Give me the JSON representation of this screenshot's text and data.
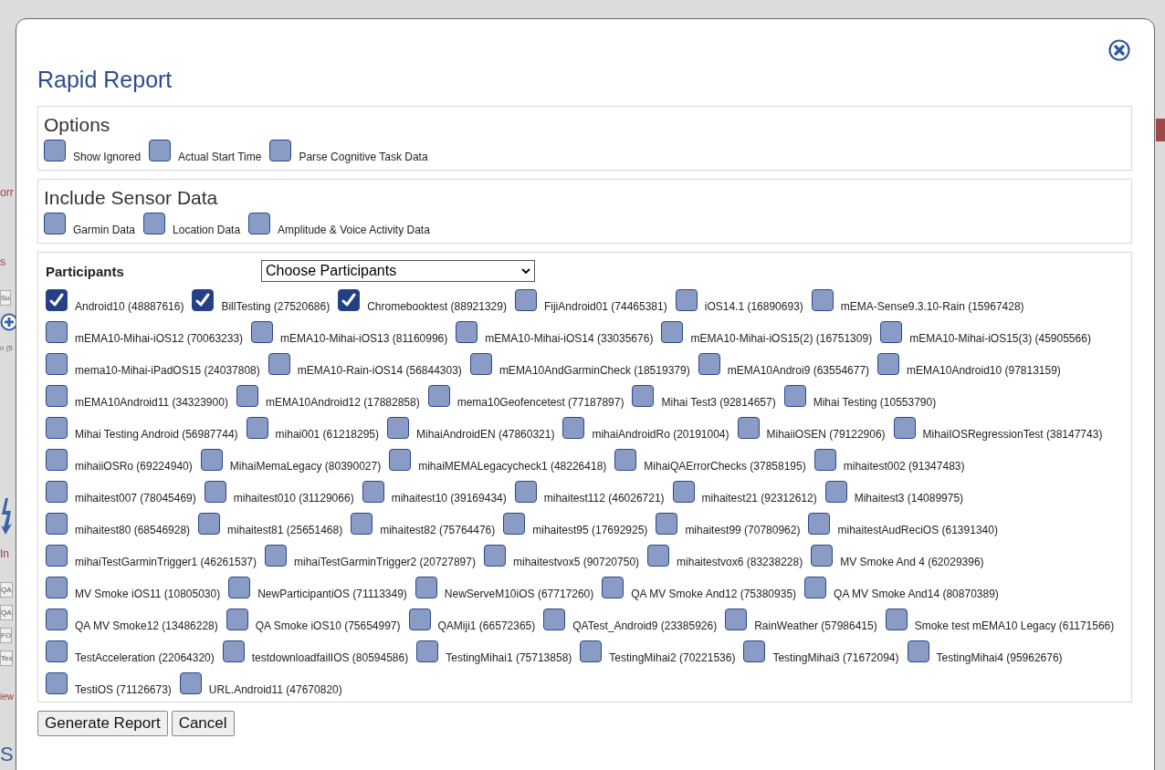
{
  "background": {
    "left_fragments": [
      {
        "kind": "heading",
        "text": "orr"
      },
      {
        "kind": "heading",
        "text": "s"
      },
      {
        "kind": "cell",
        "text": "Su"
      },
      {
        "kind": "plus"
      },
      {
        "kind": "text",
        "text": "n (5"
      },
      {
        "kind": "bolt"
      },
      {
        "kind": "heading",
        "text": "In"
      },
      {
        "kind": "cell",
        "text": "QA"
      },
      {
        "kind": "cell",
        "text": "QA"
      },
      {
        "kind": "cell",
        "text": "FO"
      },
      {
        "kind": "cell",
        "text": "Tex"
      },
      {
        "kind": "link",
        "text": "iew"
      },
      {
        "kind": "title",
        "text": "S"
      }
    ]
  },
  "dialog": {
    "title": "Rapid Report"
  },
  "options": {
    "heading": "Options",
    "items": [
      {
        "label": "Show Ignored",
        "checked": false
      },
      {
        "label": "Actual Start Time",
        "checked": false
      },
      {
        "label": "Parse Cognitive Task Data",
        "checked": false
      }
    ]
  },
  "sensor_data": {
    "heading": "Include Sensor Data",
    "items": [
      {
        "label": "Garmin Data",
        "checked": false
      },
      {
        "label": "Location Data",
        "checked": false
      },
      {
        "label": "Amplitude & Voice Activity Data",
        "checked": false
      }
    ]
  },
  "participants": {
    "heading": "Participants",
    "select": {
      "value": "Choose Participants"
    },
    "items": [
      {
        "label": "Android10 (48887616)",
        "checked": true
      },
      {
        "label": "BillTesting (27520686)",
        "checked": true
      },
      {
        "label": "Chromebooktest (88921329)",
        "checked": true
      },
      {
        "label": "FijiAndroid01 (74465381)",
        "checked": false
      },
      {
        "label": "iOS14.1 (16890693)",
        "checked": false
      },
      {
        "label": "mEMA-Sense9.3.10-Rain (15967428)",
        "checked": false
      },
      {
        "label": "mEMA10-Mihai-iOS12 (70063233)",
        "checked": false
      },
      {
        "label": "mEMA10-Mihai-iOS13 (81160996)",
        "checked": false
      },
      {
        "label": "mEMA10-Mihai-iOS14 (33035676)",
        "checked": false
      },
      {
        "label": "mEMA10-Mihai-iOS15(2) (16751309)",
        "checked": false
      },
      {
        "label": "mEMA10-Mihai-iOS15(3) (45905566)",
        "checked": false
      },
      {
        "label": "mema10-Mihai-iPadOS15 (24037808)",
        "checked": false
      },
      {
        "label": "mEMA10-Rain-iOS14 (56844303)",
        "checked": false
      },
      {
        "label": "mEMA10AndGarminCheck (18519379)",
        "checked": false
      },
      {
        "label": "mEMA10Androi9 (63554677)",
        "checked": false
      },
      {
        "label": "mEMA10Android10 (97813159)",
        "checked": false
      },
      {
        "label": "mEMA10Android11 (34323900)",
        "checked": false
      },
      {
        "label": "mEMA10Android12 (17882858)",
        "checked": false
      },
      {
        "label": "mema10Geofencetest (77187897)",
        "checked": false
      },
      {
        "label": "Mihai Test3 (92814657)",
        "checked": false
      },
      {
        "label": "Mihai Testing (10553790)",
        "checked": false
      },
      {
        "label": "Mihai Testing Android (56987744)",
        "checked": false
      },
      {
        "label": "mihai001 (61218295)",
        "checked": false
      },
      {
        "label": "MihaiAndroidEN (47860321)",
        "checked": false
      },
      {
        "label": "mihaiAndroidRo (20191004)",
        "checked": false
      },
      {
        "label": "MihaiiOSEN (79122906)",
        "checked": false
      },
      {
        "label": "MihaiIOSRegressionTest (38147743)",
        "checked": false
      },
      {
        "label": "mihaiiOSRo (69224940)",
        "checked": false
      },
      {
        "label": "MihaiMemaLegacy (80390027)",
        "checked": false
      },
      {
        "label": "mihaiMEMALegacycheck1 (48226418)",
        "checked": false
      },
      {
        "label": "MihaiQAErrorChecks (37858195)",
        "checked": false
      },
      {
        "label": "mihaitest002 (91347483)",
        "checked": false
      },
      {
        "label": "mihaitest007 (78045469)",
        "checked": false
      },
      {
        "label": "mihaitest010 (31129066)",
        "checked": false
      },
      {
        "label": "mihaitest10 (39169434)",
        "checked": false
      },
      {
        "label": "mihaitest112 (46026721)",
        "checked": false
      },
      {
        "label": "mihaitest21 (92312612)",
        "checked": false
      },
      {
        "label": "Mihaitest3 (14089975)",
        "checked": false
      },
      {
        "label": "mihaitest80 (68546928)",
        "checked": false
      },
      {
        "label": "mihaitest81 (25651468)",
        "checked": false
      },
      {
        "label": "mihaitest82 (75764476)",
        "checked": false
      },
      {
        "label": "mihaitest95 (17692925)",
        "checked": false
      },
      {
        "label": "mihaitest99 (70780962)",
        "checked": false
      },
      {
        "label": "mihaitestAudReciOS (61391340)",
        "checked": false
      },
      {
        "label": "mihaiTestGarminTrigger1 (46261537)",
        "checked": false
      },
      {
        "label": "mihaiTestGarminTrigger2 (20727897)",
        "checked": false
      },
      {
        "label": "mihaitestvox5 (90720750)",
        "checked": false
      },
      {
        "label": "mihaitestvox6 (83238228)",
        "checked": false
      },
      {
        "label": "MV Smoke And 4 (62029396)",
        "checked": false
      },
      {
        "label": "MV Smoke iOS11 (10805030)",
        "checked": false
      },
      {
        "label": "NewParticipantiOS (71113349)",
        "checked": false
      },
      {
        "label": "NewServeM10iOS (67717260)",
        "checked": false
      },
      {
        "label": "QA MV Smoke And12 (75380935)",
        "checked": false
      },
      {
        "label": "QA MV Smoke And14 (80870389)",
        "checked": false
      },
      {
        "label": "QA MV Smoke12 (13486228)",
        "checked": false
      },
      {
        "label": "QA Smoke iOS10 (75654997)",
        "checked": false
      },
      {
        "label": "QAMiji1 (66572365)",
        "checked": false
      },
      {
        "label": "QATest_Android9 (23385926)",
        "checked": false
      },
      {
        "label": "RainWeather (57986415)",
        "checked": false
      },
      {
        "label": "Smoke test mEMA10 Legacy (61171566)",
        "checked": false
      },
      {
        "label": "TestAcceleration (22064320)",
        "checked": false
      },
      {
        "label": "testdownloadfailIOS (80594586)",
        "checked": false
      },
      {
        "label": "TestingMihai1 (75713858)",
        "checked": false
      },
      {
        "label": "TestingMihai2 (70221536)",
        "checked": false
      },
      {
        "label": "TestingMihai3 (71672094)",
        "checked": false
      },
      {
        "label": "TestingMihai4 (95962676)",
        "checked": false
      },
      {
        "label": "TestiOS (71126673)",
        "checked": false
      },
      {
        "label": "URL.Android11 (47670820)",
        "checked": false
      }
    ]
  },
  "buttons": [
    "Generate Report",
    "Cancel"
  ]
}
